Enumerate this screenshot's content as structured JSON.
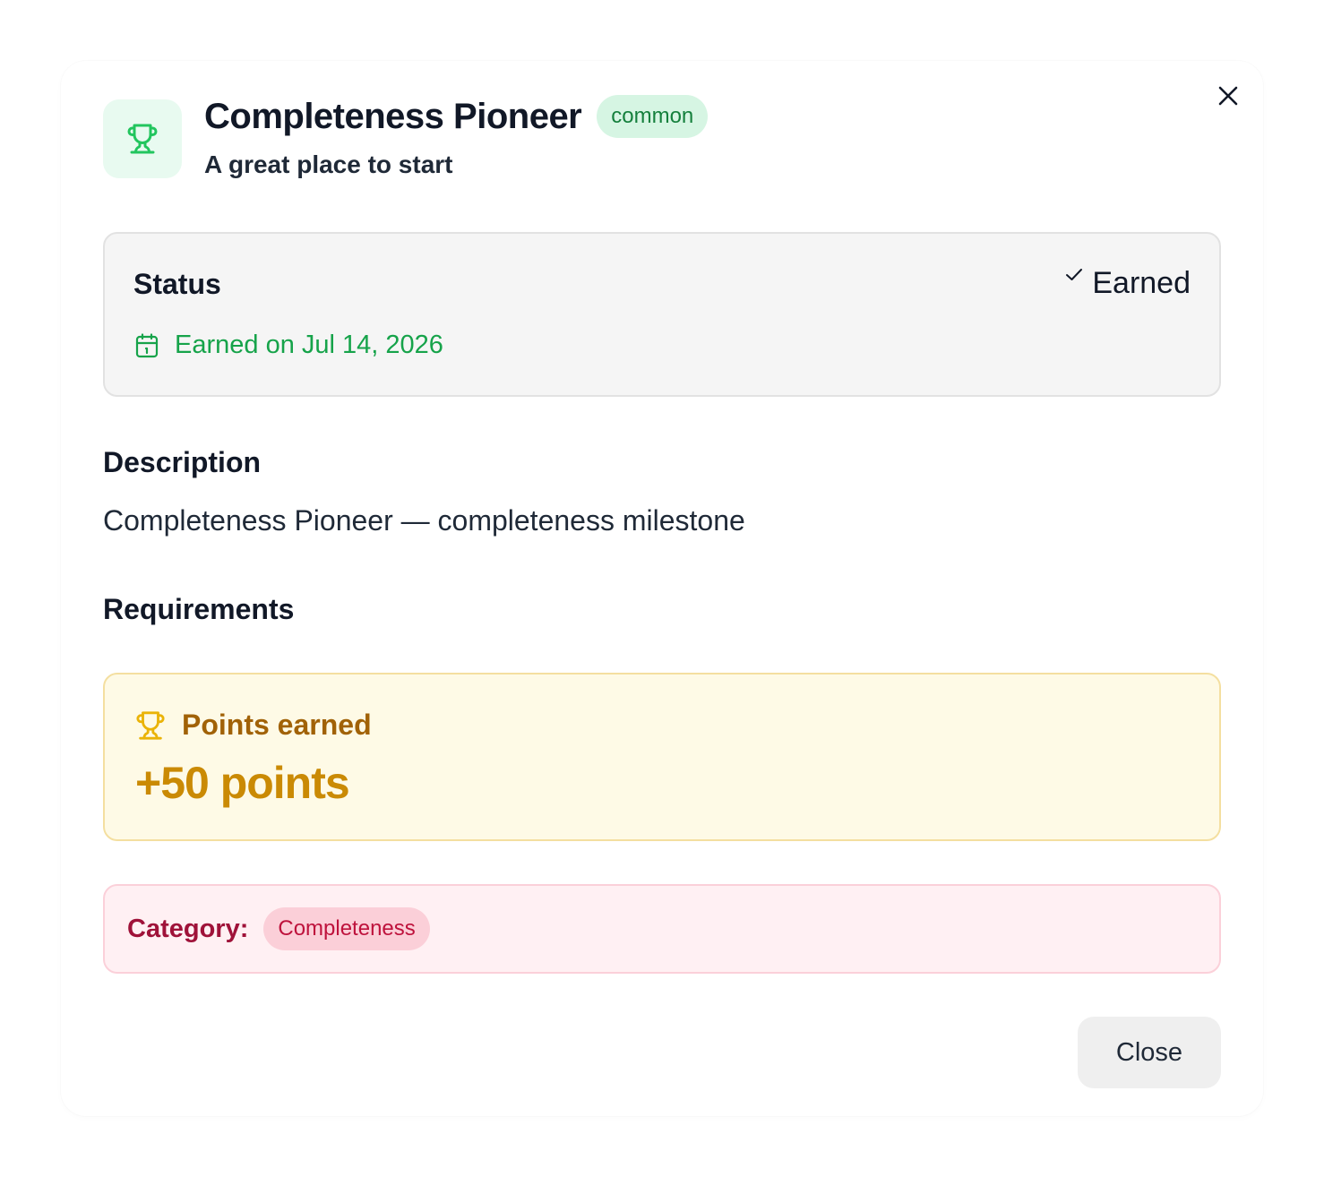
{
  "achievement": {
    "title": "Completeness Pioneer",
    "rarity": "common",
    "subtitle": "A great place to start"
  },
  "icons": {
    "close": "close-icon",
    "trophy": "trophy-icon",
    "check": "check-icon",
    "calendar": "calendar-icon"
  },
  "status": {
    "label": "Status",
    "value": "Earned",
    "earned_on": "Earned on Jul 14, 2026"
  },
  "description": {
    "heading": "Description",
    "text": "Completeness Pioneer — completeness milestone"
  },
  "requirements": {
    "heading": "Requirements"
  },
  "points": {
    "label": "Points earned",
    "value": "+50 points"
  },
  "category": {
    "label": "Category:",
    "value": "Completeness"
  },
  "footer": {
    "close_label": "Close"
  },
  "colors": {
    "success": "#16a34a",
    "success_bg": "#e8faf0",
    "points": "#ca8a04",
    "points_bg": "#fefae6",
    "category": "#be123c",
    "category_bg": "#fff0f3"
  }
}
